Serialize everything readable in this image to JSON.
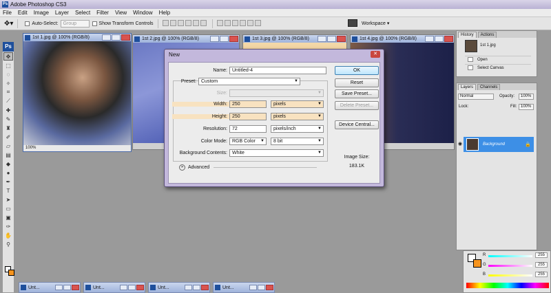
{
  "app": {
    "title": "Adobe Photoshop CS3"
  },
  "menu": [
    "File",
    "Edit",
    "Image",
    "Layer",
    "Select",
    "Filter",
    "View",
    "Window",
    "Help"
  ],
  "options": {
    "auto_select_label": "Auto-Select:",
    "auto_select_value": "Group",
    "show_transform_label": "Show Transform Controls",
    "workspace_label": "Workspace ▾"
  },
  "toolbox": {
    "logo": "Ps"
  },
  "documents": [
    {
      "title": "1st 1.jpg @ 100% (RGB/8)",
      "status": "100%"
    },
    {
      "title": "1st 2.jpg @ 100% (RGB/8)"
    },
    {
      "title": "1st 3.jpg @ 100% (RGB/8)"
    },
    {
      "title": "1st 4.jpg @ 100% (RGB/8)"
    }
  ],
  "dialog": {
    "title": "New",
    "close_label": "✕",
    "name_label": "Name:",
    "name_value": "Untitled-4",
    "preset_label": "Preset:",
    "preset_value": "Custom",
    "size_label": "Size:",
    "width_label": "Width:",
    "width_value": "250",
    "width_unit": "pixels",
    "height_label": "Height:",
    "height_value": "250",
    "height_unit": "pixels",
    "resolution_label": "Resolution:",
    "resolution_value": "72",
    "resolution_unit": "pixels/inch",
    "color_mode_label": "Color Mode:",
    "color_mode_value": "RGB Color",
    "bit_depth_value": "8 bit",
    "bg_contents_label": "Background Contents:",
    "bg_contents_value": "White",
    "advanced_label": "Advanced",
    "buttons": {
      "ok": "OK",
      "reset": "Reset",
      "save_preset": "Save Preset...",
      "delete_preset": "Delete Preset...",
      "device_central": "Device Central..."
    },
    "image_size_label": "Image Size:",
    "image_size_value": "183.1K"
  },
  "history_panel": {
    "tabs": [
      "History",
      "Actions"
    ],
    "snapshot_name": "1st 1.jpg",
    "items": [
      "Open",
      "Select Canvas"
    ]
  },
  "layers_panel": {
    "tabs": [
      "Layers",
      "Channels"
    ],
    "blend_mode": "Normal",
    "opacity_label": "Opacity:",
    "opacity_value": "100%",
    "lock_label": "Lock:",
    "fill_label": "Fill:",
    "fill_value": "100%",
    "layer_name": "Background"
  },
  "color_panel": {
    "r_label": "R",
    "g_label": "G",
    "b_label": "B",
    "r_value": "255",
    "g_value": "255",
    "b_value": "255"
  },
  "minimized": [
    {
      "label": "Unt..."
    },
    {
      "label": "Unt..."
    },
    {
      "label": "Unt..."
    },
    {
      "label": "Unt..."
    }
  ],
  "colors": {
    "dialog_frame": "#c3b8dc",
    "highlight_field": "#f8e2c0",
    "layer_selected": "#3d8fe6",
    "background_swatch": "#f7941d"
  }
}
